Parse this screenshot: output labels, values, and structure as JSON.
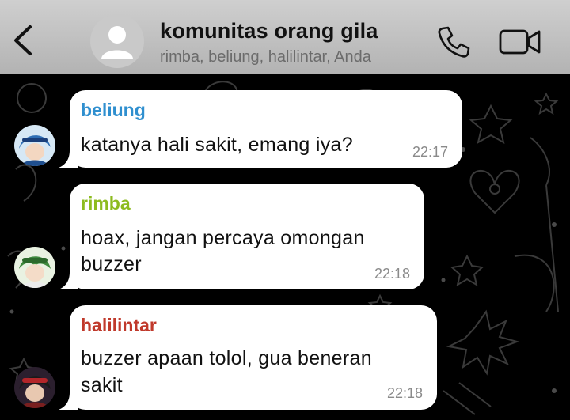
{
  "header": {
    "title": "komunitas orang gila",
    "subtitle": "rimba, beliung, halilintar, Anda"
  },
  "messages": [
    {
      "sender": "beliung",
      "sender_color": "#2f8fcf",
      "lines": [
        "katanya hali sakit, emang iya?"
      ],
      "time": "22:17"
    },
    {
      "sender": "rimba",
      "sender_color": "#8dbb1f",
      "lines": [
        "hoax, jangan percaya omongan",
        "buzzer"
      ],
      "time": "22:18"
    },
    {
      "sender": "halilintar",
      "sender_color": "#c0392b",
      "lines": [
        "buzzer apaan tolol, gua beneran",
        "sakit"
      ],
      "time": "22:18"
    }
  ]
}
